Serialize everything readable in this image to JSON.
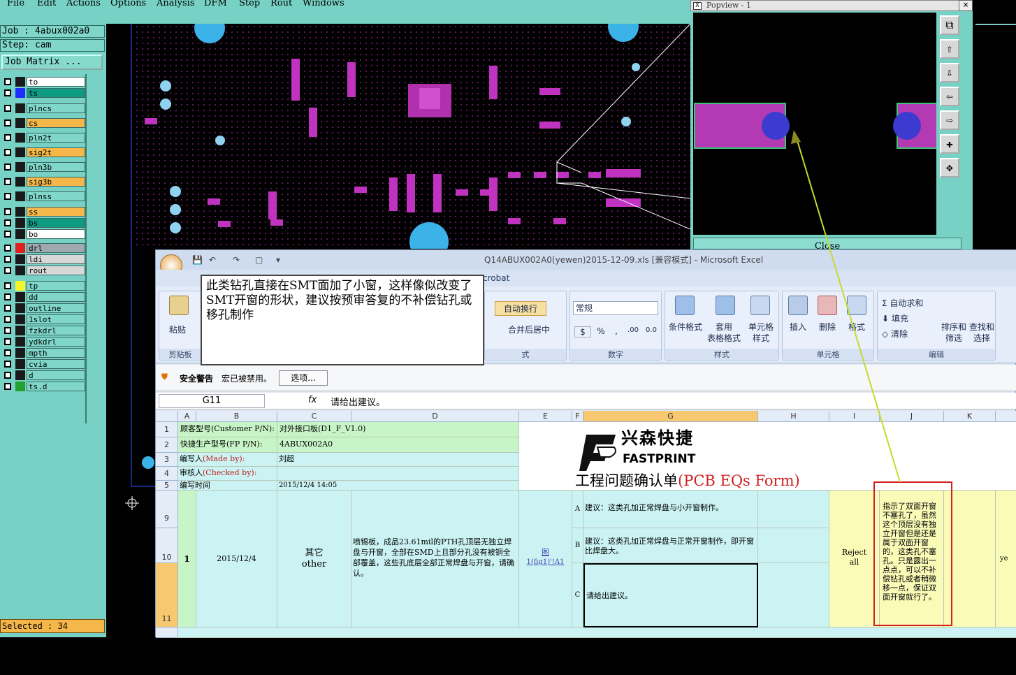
{
  "menu": {
    "file": "File",
    "edit": "Edit",
    "actions": "Actions",
    "options": "Options",
    "analysis": "Analysis",
    "dfm": "DFM",
    "step": "Step",
    "rout": "Rout",
    "windows": "Windows"
  },
  "job": {
    "job_label": "Job : 4abux002a0",
    "step_label": "Step: cam",
    "matrix_button": "Job Matrix ..."
  },
  "layers": [
    {
      "name": "to",
      "color": "#ffffff",
      "swatch": "#1a1a1a"
    },
    {
      "name": "ts",
      "color": "#0d9b84",
      "swatch": "#1d2fff"
    },
    {
      "name": "plncs",
      "color": "#7fd6c9",
      "swatch": "#1a1a1a"
    },
    {
      "name": "cs",
      "color": "#f5b74a",
      "swatch": "#1a1a1a"
    },
    {
      "name": "pln2t",
      "color": "#7fd6c9",
      "swatch": "#1a1a1a"
    },
    {
      "name": "sig2t",
      "color": "#f5b74a",
      "swatch": "#1a1a1a"
    },
    {
      "name": "pln3b",
      "color": "#7fd6c9",
      "swatch": "#1a1a1a"
    },
    {
      "name": "sig3b",
      "color": "#f5b74a",
      "swatch": "#1a1a1a"
    },
    {
      "name": "plnss",
      "color": "#7fd6c9",
      "swatch": "#1a1a1a"
    },
    {
      "name": "ss",
      "color": "#f5b74a",
      "swatch": "#1a1a1a"
    },
    {
      "name": "bs",
      "color": "#0d9b84",
      "swatch": "#1a1a1a"
    },
    {
      "name": "bo",
      "color": "#ffffff",
      "swatch": "#1a1a1a"
    },
    {
      "name": "drl",
      "color": "#a0a8b0",
      "swatch": "#e02020"
    },
    {
      "name": "ldi",
      "color": "#d8d8d8",
      "swatch": "#1a1a1a"
    },
    {
      "name": "rout",
      "color": "#d8d8d8",
      "swatch": "#1a1a1a"
    },
    {
      "name": "tp",
      "color": "#7fd6c9",
      "swatch": "#f5f52a"
    },
    {
      "name": "dd",
      "color": "#7fd6c9",
      "swatch": "#1a1a1a"
    },
    {
      "name": "outline",
      "color": "#7fd6c9",
      "swatch": "#1a1a1a"
    },
    {
      "name": "1slot",
      "color": "#7fd6c9",
      "swatch": "#1a1a1a"
    },
    {
      "name": "fzkdrl",
      "color": "#7fd6c9",
      "swatch": "#1a1a1a"
    },
    {
      "name": "ydkdrl",
      "color": "#7fd6c9",
      "swatch": "#1a1a1a"
    },
    {
      "name": "mpth",
      "color": "#7fd6c9",
      "swatch": "#1a1a1a"
    },
    {
      "name": "cvia",
      "color": "#7fd6c9",
      "swatch": "#1a1a1a"
    },
    {
      "name": "d",
      "color": "#7fd6c9",
      "swatch": "#1a1a1a"
    },
    {
      "name": "ts.d",
      "color": "#7fd6c9",
      "swatch": "#22a030"
    }
  ],
  "status": {
    "selected": "Selected : 34"
  },
  "popview": {
    "title": "Popview - 1",
    "close": "Close",
    "close_x": "×"
  },
  "excel": {
    "title": "Q14ABUX002A0(yewen)2015-12-09.xls  [兼容模式] - Microsoft Excel",
    "acrobat_tab": "Acrobat",
    "ribbon": {
      "paste": "粘贴",
      "clipboard": "剪贴板",
      "wrap": "自动换行",
      "merge": "合并后居中",
      "align_group": "式",
      "numfmt": "常规",
      "number_group": "数字",
      "cond": "条件格式",
      "table1": "套用",
      "table2": "表格格式",
      "cellstyle1": "单元格",
      "cellstyle2": "样式",
      "style_group": "样式",
      "insert": "插入",
      "delete": "删除",
      "format": "格式",
      "cells_group": "单元格",
      "autosum": "自动求和",
      "fill": "填充",
      "clear": "清除",
      "sort1": "排序和",
      "sort2": "筛选",
      "find1": "查找和",
      "find2": "选择",
      "edit_group": "编辑",
      "pct": "%",
      "comma": ",",
      "inc": ".00",
      "dec": "0.0"
    },
    "security": {
      "title": "安全警告",
      "msg": "宏已被禁用。",
      "options": "选项..."
    },
    "formula": {
      "namebox": "G11",
      "fx": "fx",
      "content": "请给出建议。"
    },
    "columns": [
      "A",
      "B",
      "C",
      "D",
      "E",
      "F",
      "G",
      "H",
      "I",
      "J",
      "K"
    ],
    "rows": {
      "r1": "1",
      "r2": "2",
      "r3": "3",
      "r4": "4",
      "r5": "5",
      "r9": "9",
      "r10": "10",
      "r11": "11"
    },
    "cells": {
      "b1": "顾客型号(Customer P/N):",
      "c1": "对外接口板(D1_F_V1.0)",
      "b2": "快捷生产型号(FP P/N):",
      "c2": "4ABUX002A0",
      "b3a": "编写人",
      "b3b": "(Made by):",
      "c3": "刘超",
      "b4a": "审核人",
      "b4b": "(Checked by):",
      "b5": "编写时间",
      "c5": "2015/12/4 14:05",
      "logo_cn": "兴森快捷",
      "logo_en": "FASTPRINT",
      "form_title_cn": "工程问题确认单",
      "form_title_en": "(PCB EQs Form)",
      "a10": "1",
      "b10": "2015/12/4",
      "c10a": "其它",
      "c10b": "other",
      "d10": "喷锡板，成品23.61mil的PTH孔顶层无独立焊盘与开窗，全部在SMD上且部分孔没有被铜全部覆盖，这些孔底层全部正常焊盘与开窗，请确认。",
      "e10a": "图",
      "e10b": "1(fig1)'!A1",
      "optA": "A",
      "g9": "建议：这类孔加正常焊盘与小开窗制作。",
      "optB": "B",
      "g10": "建议：这类孔加正常焊盘与正常开窗制作，即开窗比焊盘大。",
      "optC": "C",
      "g11": "请给出建议。",
      "i10a": "Reject",
      "i10b": "all",
      "j10": "指示了双面开窗不塞孔了，虽然这个顶层没有独立开窗但是还是属于双面开窗的，这类孔不塞孔。只是露出一点点，可以不补偿钻孔或者稍微移一点，保证双面开窗就行了。",
      "l10": "ye"
    }
  },
  "callout": "此类钻孔直接在SMT面加了小窗，这样像似改变了SMT开窗的形状，建议按预审答复的不补偿钻孔或移孔制作"
}
